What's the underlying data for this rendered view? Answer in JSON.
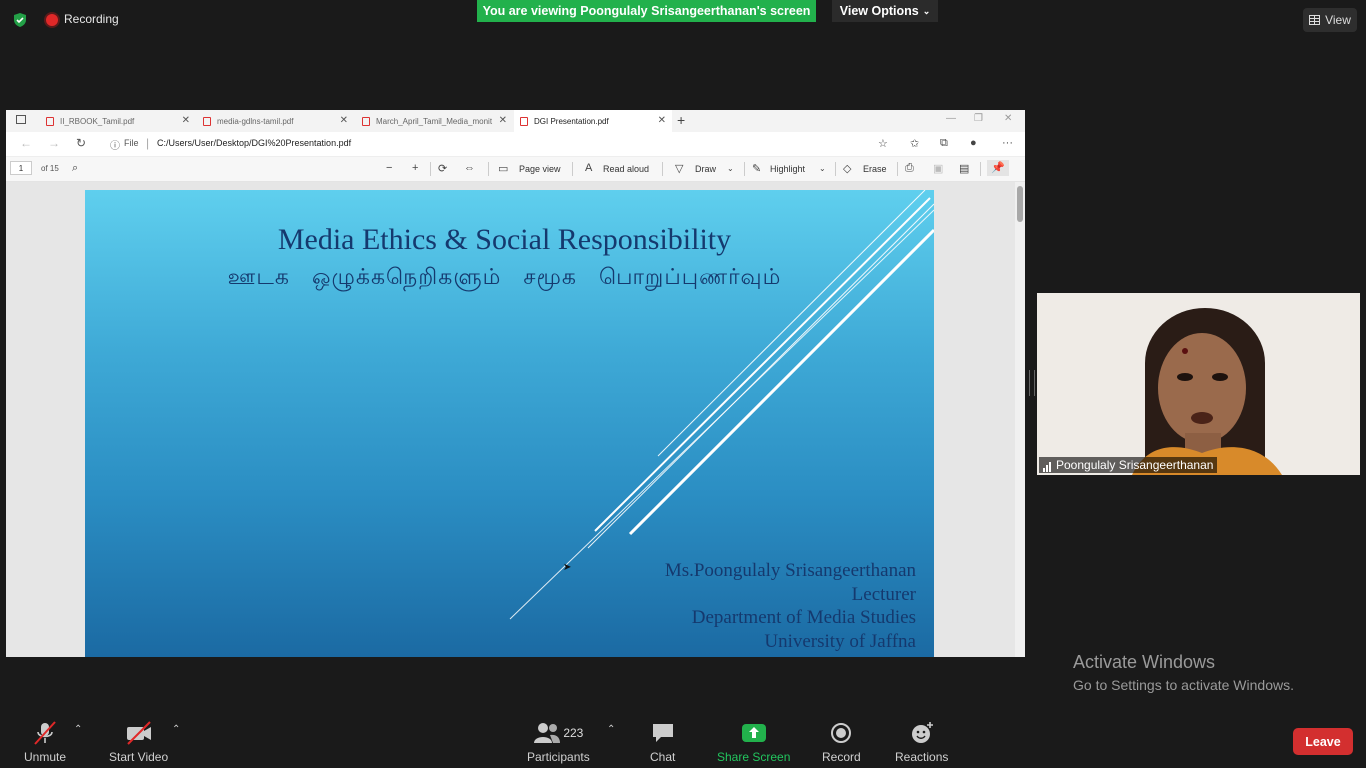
{
  "top_bar": {
    "recording_label": "Recording",
    "share_banner": "You are viewing Poongulaly Srisangeerthanan's screen",
    "view_options_label": "View Options",
    "view_label": "View"
  },
  "browser": {
    "tabs": [
      {
        "label": "II_RBOOK_Tamil.pdf",
        "active": false
      },
      {
        "label": "media-gdlns-tamil.pdf",
        "active": false
      },
      {
        "label": "March_April_Tamil_Media_monit",
        "active": false
      },
      {
        "label": "DGI Presentation.pdf",
        "active": true
      }
    ],
    "address_prefix": "File",
    "url": "C:/Users/User/Desktop/DGI%20Presentation.pdf"
  },
  "pdf_toolbar": {
    "page_number": "1",
    "page_total": "of 15",
    "page_view_label": "Page view",
    "read_aloud_label": "Read aloud",
    "draw_label": "Draw",
    "highlight_label": "Highlight",
    "erase_label": "Erase"
  },
  "slide": {
    "title": "Media Ethics & Social Responsibility",
    "subtitle": "ஊடக ஒழுக்கநெறிகளும் சமூக பொறுப்புணர்வும்",
    "presenter": "Ms.Poongulaly Srisangeerthanan",
    "role": "Lecturer",
    "department": "Department of Media Studies",
    "university": "University of Jaffna"
  },
  "video": {
    "participant_name": "Poongulaly Srisangeerthanan"
  },
  "watermark": {
    "title": "Activate Windows",
    "subtitle": "Go to Settings to activate Windows."
  },
  "controls": {
    "unmute_label": "Unmute",
    "start_video_label": "Start Video",
    "participants_label": "Participants",
    "participants_count": "223",
    "chat_label": "Chat",
    "share_screen_label": "Share Screen",
    "record_label": "Record",
    "reactions_label": "Reactions",
    "leave_label": "Leave"
  },
  "colors": {
    "share_green": "#22b14c",
    "leave_red": "#d32f2f",
    "slide_text": "#15396e"
  }
}
